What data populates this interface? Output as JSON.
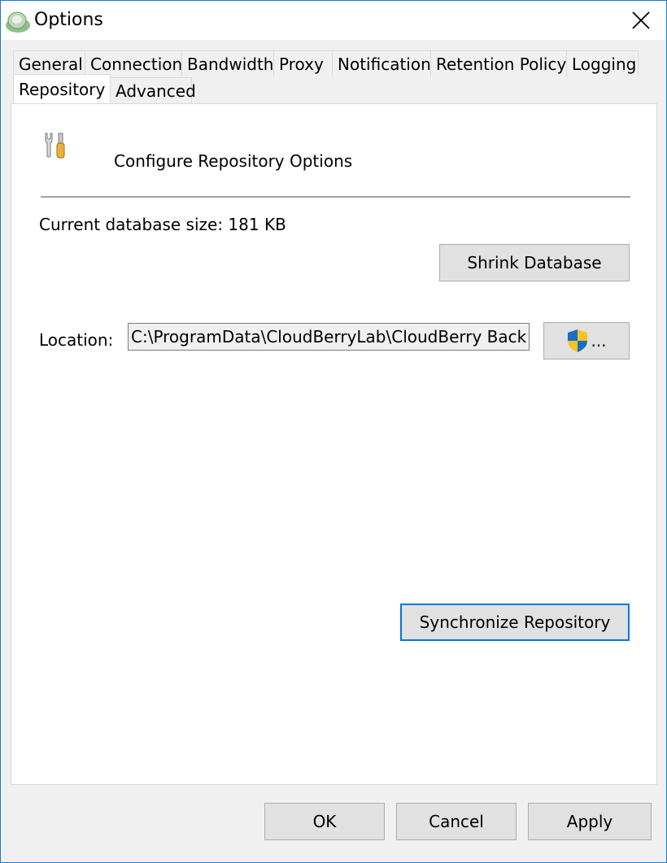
{
  "window": {
    "title": "Options"
  },
  "tabs": {
    "row1": [
      "General",
      "Connection",
      "Bandwidth",
      "Proxy",
      "Notification",
      "Retention Policy",
      "Logging"
    ],
    "row2": [
      "Repository",
      "Advanced"
    ],
    "active": "Repository"
  },
  "repository": {
    "heading": "Configure Repository Options",
    "db_size_label": "Current database size: 181 KB",
    "shrink_label": "Shrink Database",
    "location_label": "Location:",
    "location_value": "C:\\ProgramData\\CloudBerryLab\\CloudBerry Backup",
    "browse_label": "...",
    "sync_label": "Synchronize Repository"
  },
  "footer": {
    "ok": "OK",
    "cancel": "Cancel",
    "apply": "Apply"
  },
  "colors": {
    "accent": "#0078d7",
    "window_border": "#1979ca",
    "shield_blue": "#1a6dc4",
    "shield_yellow": "#f6c324"
  },
  "icons": {
    "app": "cloudberry-icon",
    "close": "close-icon",
    "tools": "tools-icon",
    "shield": "uac-shield-icon"
  }
}
